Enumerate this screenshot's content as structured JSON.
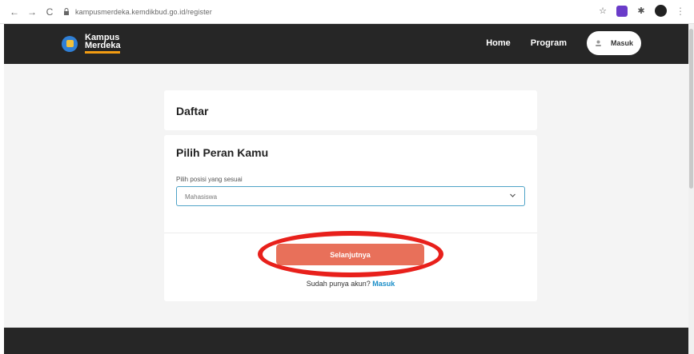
{
  "browser": {
    "url": "kampusmerdeka.kemdikbud.go.id/register",
    "back_icon": "←",
    "forward_icon": "→",
    "reload_icon": "C",
    "lock_icon": "🔒",
    "star_icon": "☆",
    "puzzle_icon": "✱",
    "menu_icon": "⋮"
  },
  "header": {
    "logo_line1": "Kampus",
    "logo_line2": "Merdeka",
    "nav": [
      "Home",
      "Program"
    ],
    "login_label": "Masuk",
    "bg_color": "#262626"
  },
  "form": {
    "card_title": "Daftar",
    "section_title": "Pilih Peran Kamu",
    "field_label": "Pilih posisi yang sesuai",
    "select_value": "Mahasiswa",
    "next_label": "Selanjutnya",
    "have_account_text": "Sudah punya akun?",
    "login_link": "Masuk",
    "accent_color": "#e8705a",
    "link_color": "#1a8ec8"
  }
}
